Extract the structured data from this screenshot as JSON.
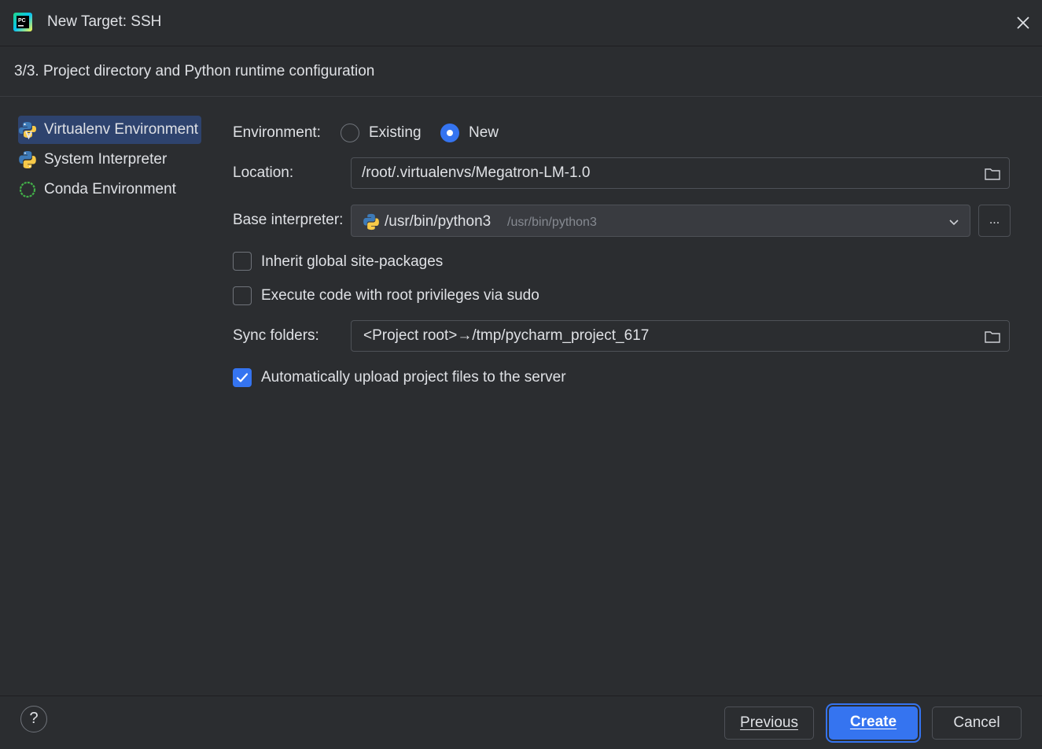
{
  "window": {
    "title": "New Target: SSH",
    "logo_icon": "pycharm-logo-icon",
    "close_icon": "close-icon"
  },
  "step": {
    "text": "3/3. Project directory and Python runtime configuration"
  },
  "sidebar": {
    "items": [
      {
        "label": "Virtualenv Environment",
        "icon": "virtualenv-icon",
        "selected": true
      },
      {
        "label": "System Interpreter",
        "icon": "python-icon",
        "selected": false
      },
      {
        "label": "Conda Environment",
        "icon": "conda-icon",
        "selected": false
      }
    ]
  },
  "form": {
    "environment_label": "Environment:",
    "environment_options": [
      {
        "label": "Existing",
        "selected": false
      },
      {
        "label": "New",
        "selected": true
      }
    ],
    "location_label": "Location:",
    "location_value": "/root/.virtualenvs/Megatron-LM-1.0",
    "base_interpreter_label": "Base interpreter:",
    "base_interpreter_value": "/usr/bin/python3",
    "base_interpreter_hint": "/usr/bin/python3",
    "browse_label": "...",
    "inherit_label": "Inherit global site-packages",
    "inherit_checked": false,
    "sudo_label": "Execute code with root privileges via sudo",
    "sudo_checked": false,
    "sync_label": "Sync folders:",
    "sync_value": "<Project root>→/tmp/pycharm_project_617",
    "auto_upload_label": "Automatically upload project files to the server",
    "auto_upload_checked": true
  },
  "footer": {
    "help_label": "?",
    "previous_label": "Previous",
    "create_label": "Create",
    "cancel_label": "Cancel"
  },
  "colors": {
    "background": "#2b2d30",
    "accent": "#3574f0",
    "selection": "#2e436e",
    "text": "#dfe1e5",
    "muted": "#868a91"
  }
}
